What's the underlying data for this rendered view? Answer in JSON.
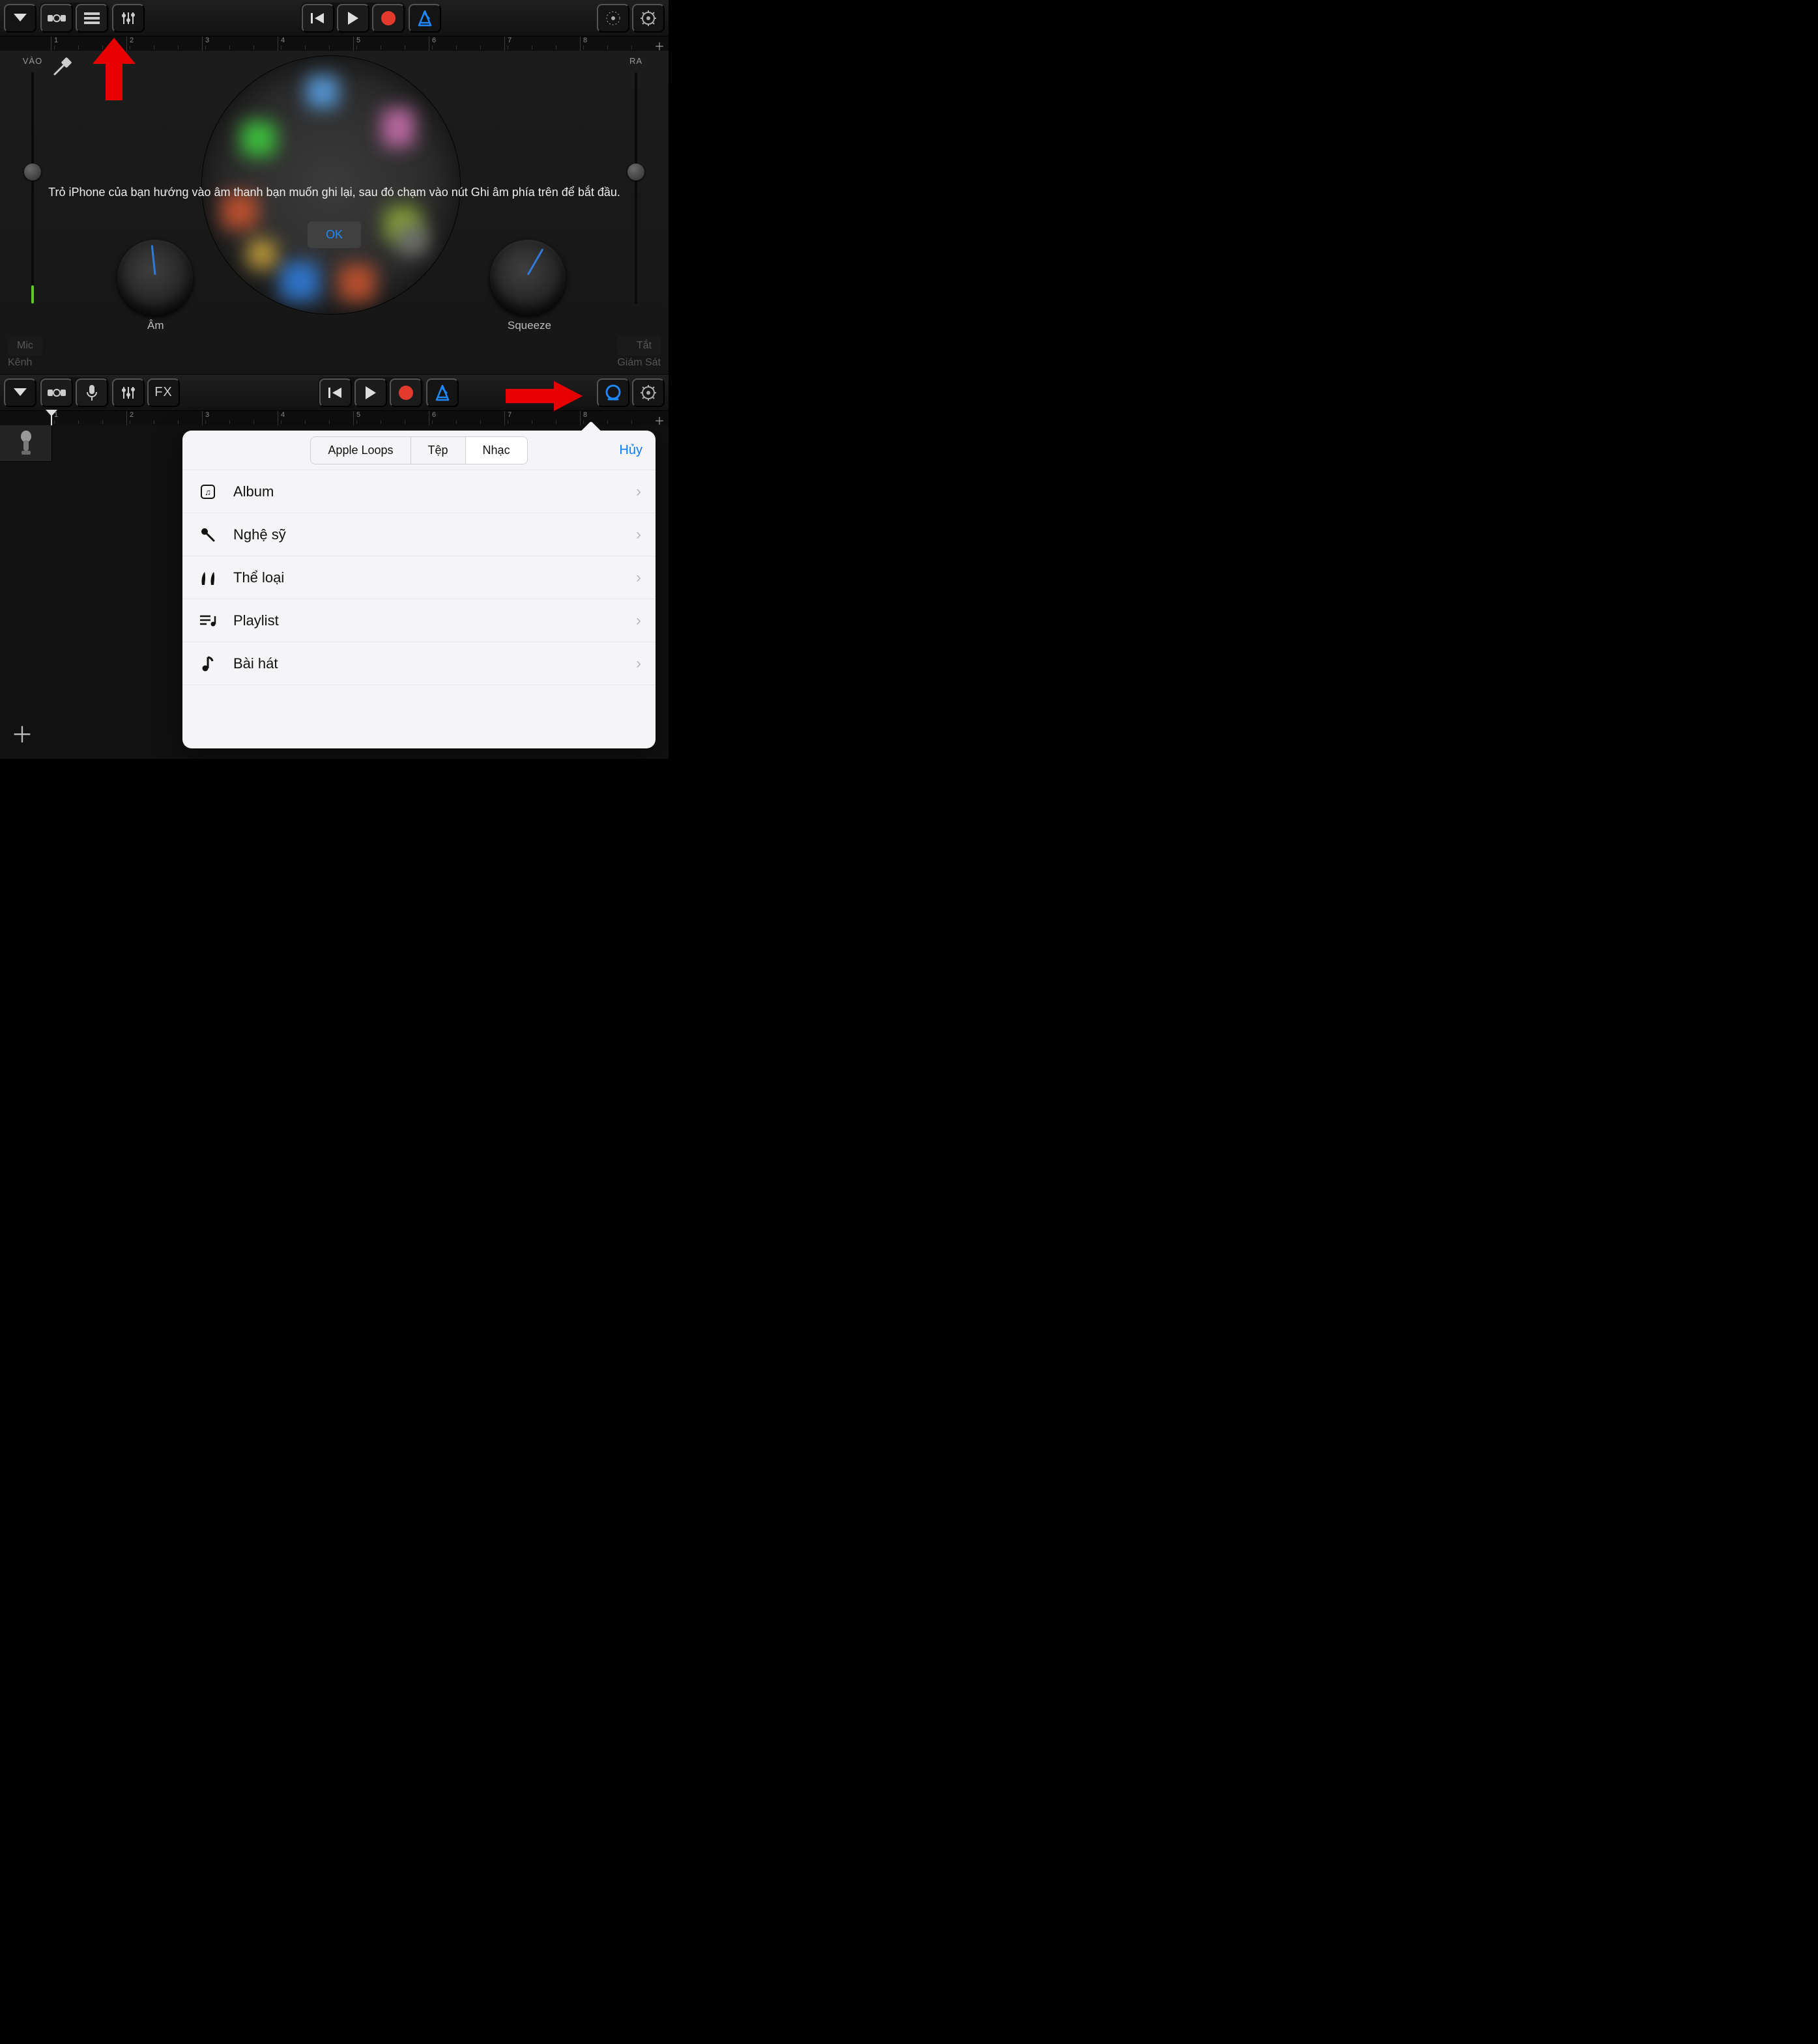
{
  "top": {
    "ruler": [
      "1",
      "2",
      "3",
      "4",
      "5",
      "6",
      "7",
      "8"
    ],
    "slider": {
      "in": "VÀO",
      "out": "RA"
    },
    "guide": "Trỏ iPhone của bạn hướng vào âm thanh bạn muốn ghi lại, sau đó chạm vào nút Ghi âm phía trên để bắt đầu.",
    "ok": "OK",
    "knob_l": "Âm",
    "knob_r": "Squeeze",
    "foot": {
      "mic": "Mic",
      "channel": "Kênh",
      "off": "Tắt",
      "monitor": "Giám Sát"
    }
  },
  "bottom": {
    "ruler": [
      "1",
      "2",
      "3",
      "4",
      "5",
      "6",
      "7",
      "8"
    ],
    "fx": "FX"
  },
  "popover": {
    "tabs": [
      "Apple Loops",
      "Tệp",
      "Nhạc"
    ],
    "selected": 2,
    "cancel": "Hủy",
    "rows": [
      {
        "icon": "album",
        "label": "Album"
      },
      {
        "icon": "mic",
        "label": "Nghệ sỹ"
      },
      {
        "icon": "guitars",
        "label": "Thể loại"
      },
      {
        "icon": "playlist",
        "label": "Playlist"
      },
      {
        "icon": "note",
        "label": "Bài hát"
      }
    ]
  }
}
